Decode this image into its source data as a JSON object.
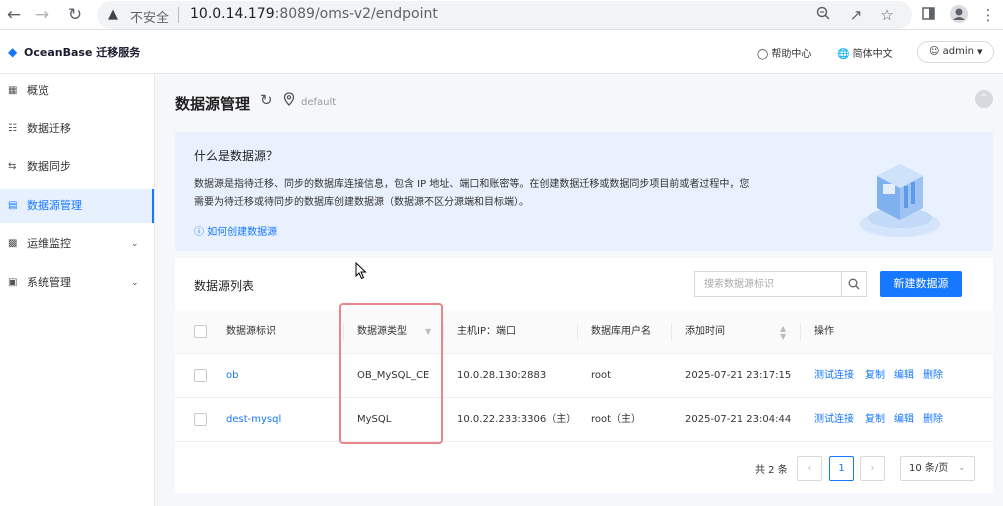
{
  "browser": {
    "back_icon": "arrow-left-icon",
    "forward_icon": "arrow-right-icon",
    "reload_icon": "reload-icon",
    "security_label": "不安全",
    "url_host": "10.0.14.179",
    "url_rest": ":8089/oms-v2/endpoint",
    "icons": [
      "zoom-icon",
      "share-icon",
      "star-icon",
      "sidepanel-icon",
      "profile-icon",
      "kebab-menu-icon"
    ]
  },
  "header": {
    "logo_text": "OceanBase 迁移服务",
    "help_label": "帮助中心",
    "language_label": "简体中文",
    "user_label": "admin"
  },
  "sidebar": {
    "items": [
      {
        "label": "概览",
        "icon": "grid-icon",
        "expandable": false,
        "active": false
      },
      {
        "label": "数据迁移",
        "icon": "hierarchy-icon",
        "expandable": false,
        "active": false
      },
      {
        "label": "数据同步",
        "icon": "sync-arrows-icon",
        "expandable": false,
        "active": false
      },
      {
        "label": "数据源管理",
        "icon": "document-list-icon",
        "expandable": false,
        "active": true
      },
      {
        "label": "运维监控",
        "icon": "monitor-icon",
        "expandable": true,
        "active": false
      },
      {
        "label": "系统管理",
        "icon": "settings-box-icon",
        "expandable": true,
        "active": false
      }
    ]
  },
  "page": {
    "title": "数据源管理",
    "tenant": "default"
  },
  "intro": {
    "title": "什么是数据源？",
    "desc_line1": "数据源是指待迁移、同步的数据库连接信息，包含 IP 地址、端口和账密等。在创建数据迁移或数据同步项目前或者过程中，您",
    "desc_line2": "需要为待迁移或待同步的数据库创建数据源（数据源不区分源端和目标端）。",
    "link_label": "如何创建数据源"
  },
  "list": {
    "title": "数据源列表",
    "search_placeholder": "搜索数据源标识",
    "create_label": "新建数据源",
    "columns": {
      "name": "数据源标识",
      "type": "数据源类型",
      "host": "主机IP：端口",
      "user": "数据库用户名",
      "time": "添加时间",
      "actions": "操作"
    },
    "rows": [
      {
        "name": "ob",
        "type": "OB_MySQL_CE",
        "host": "10.0.28.130:2883",
        "user": "root",
        "time": "2025-07-21 23:17:15"
      },
      {
        "name": "dest-mysql",
        "type": "MySQL",
        "host": "10.0.22.233:3306（主）",
        "user": "root（主）",
        "time": "2025-07-21 23:04:44"
      }
    ],
    "actions": [
      "测试连接",
      "复制",
      "编辑",
      "删除"
    ]
  },
  "pagination": {
    "total": "共 2 条",
    "current": "1",
    "page_size": "10 条/页"
  },
  "colors": {
    "primary": "#1677ff",
    "intro_bg": "#e8f1fd",
    "highlight_border": "#e8868c"
  }
}
